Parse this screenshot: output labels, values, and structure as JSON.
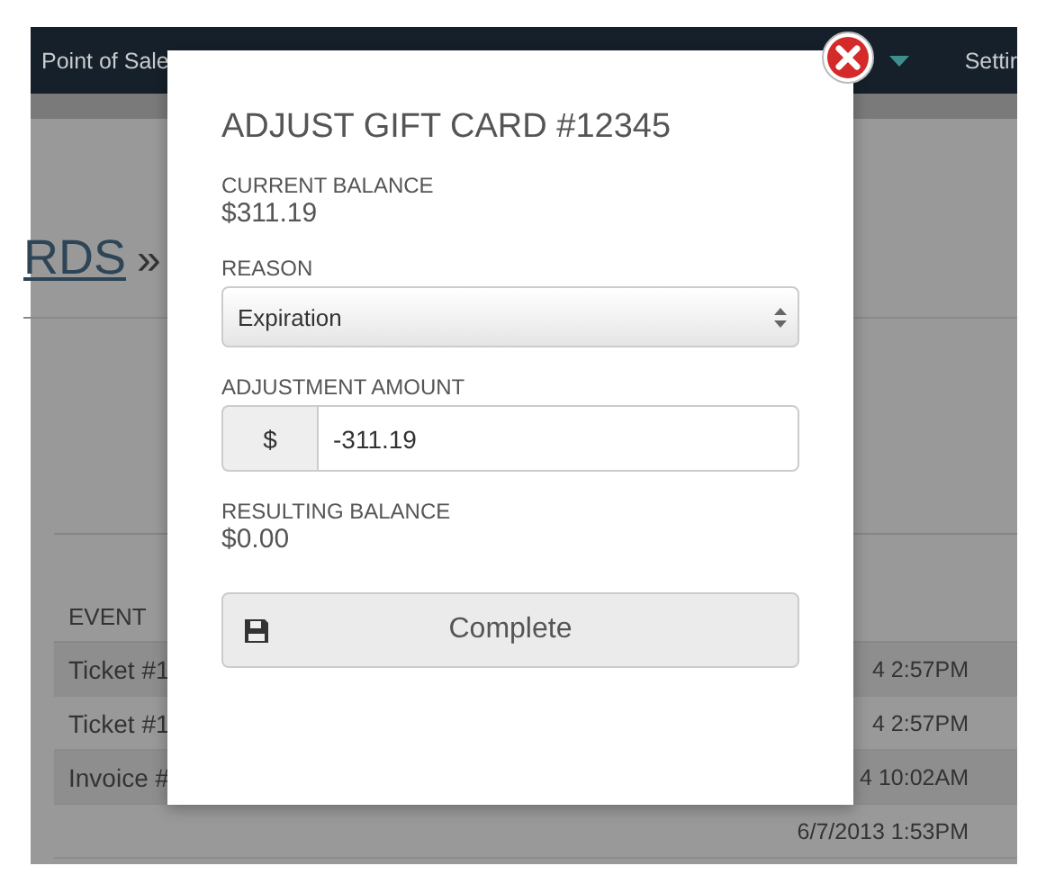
{
  "nav": {
    "items": [
      {
        "label": "Point of Sale"
      },
      {
        "label": "Settir"
      }
    ]
  },
  "breadcrumb": {
    "link": "RDS",
    "separator": "»"
  },
  "table": {
    "columns": [
      "EVENT"
    ],
    "rows": [
      {
        "event": "Ticket #1",
        "date": "4 2:57PM"
      },
      {
        "event": "Ticket #1",
        "date": "4 2:57PM"
      },
      {
        "event": "Invoice #",
        "date": "4 10:02AM"
      },
      {
        "event": "",
        "date": "6/7/2013 1:53PM"
      }
    ]
  },
  "modal": {
    "title": "ADJUST GIFT CARD #12345",
    "current_balance": {
      "label": "CURRENT BALANCE",
      "value": "$311.19"
    },
    "reason": {
      "label": "REASON",
      "value": "Expiration"
    },
    "adjustment": {
      "label": "ADJUSTMENT AMOUNT",
      "prefix": "$",
      "value": "-311.19"
    },
    "resulting_balance": {
      "label": "RESULTING BALANCE",
      "value": "$0.00"
    },
    "button": "Complete"
  }
}
